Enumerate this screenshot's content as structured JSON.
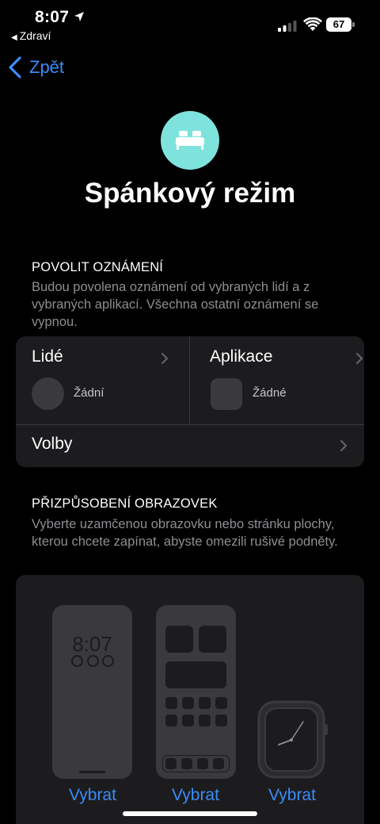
{
  "status_bar": {
    "time": "8:07",
    "back_app": "Zdraví",
    "battery": "67"
  },
  "nav": {
    "back_label": "Zpět"
  },
  "header": {
    "icon": "bed-icon",
    "title": "Spánkový režim",
    "accent_color": "#7fe3dd"
  },
  "allow_notifications": {
    "title": "POVOLIT OZNÁMENÍ",
    "description": "Budou povolena oznámení od vybraných lidí a z vybraných aplikací. Všechna ostatní oznámení se vypnou.",
    "people": {
      "label": "Lidé",
      "value": "Žádní"
    },
    "apps": {
      "label": "Aplikace",
      "value": "Žádné"
    },
    "options_label": "Volby"
  },
  "customize_screens": {
    "title": "PŘIZPŮSOBENÍ OBRAZOVEK",
    "description": "Vyberte uzamčenou obrazovku nebo stránku plochy, kterou chcete zapínat, abyste omezili rušivé podněty.",
    "lock_screen_time": "8:07",
    "choose_lock": "Vybrat",
    "choose_home": "Vybrat",
    "choose_watch": "Vybrat"
  },
  "colors": {
    "link": "#3b8cf7",
    "card": "#1c1c1e"
  }
}
